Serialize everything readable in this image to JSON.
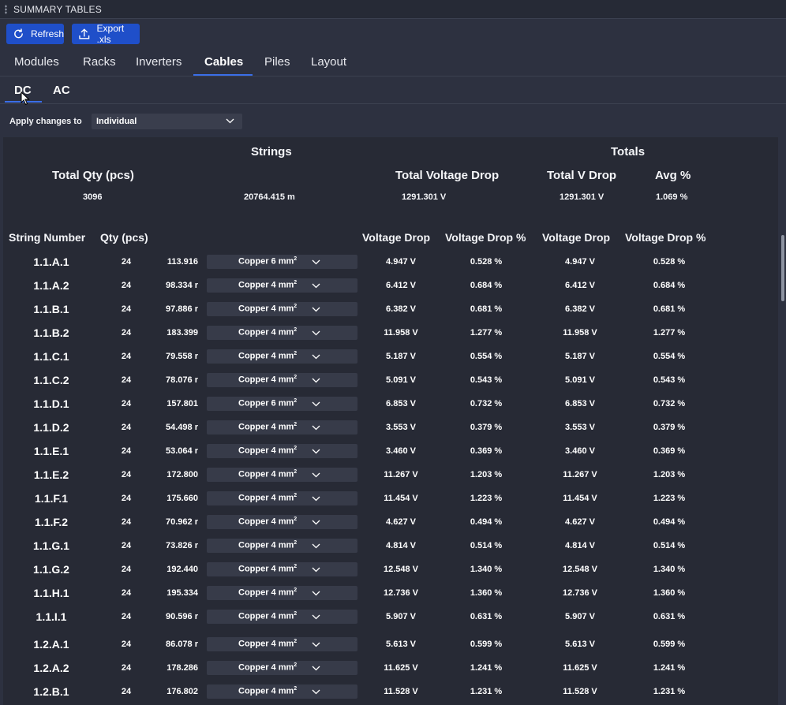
{
  "window": {
    "title": "SUMMARY TABLES"
  },
  "toolbar": {
    "refresh_label": "Refresh",
    "export_label": "Export .xls"
  },
  "tabs": [
    {
      "label": "Modules"
    },
    {
      "label": "Racks"
    },
    {
      "label": "Inverters"
    },
    {
      "label": "Cables",
      "active": true
    },
    {
      "label": "Piles"
    },
    {
      "label": "Layout"
    }
  ],
  "subtabs": [
    {
      "label": "DC",
      "active": true
    },
    {
      "label": "AC"
    }
  ],
  "apply": {
    "label": "Apply changes to",
    "selected": "Individual"
  },
  "summary": {
    "strings_header": "Strings",
    "totals_header": "Totals",
    "total_qty_label": "Total Qty (pcs)",
    "total_vdrop_label": "Total Voltage Drop",
    "totals_vdrop_label": "Total V Drop",
    "avg_label": "Avg %",
    "total_qty": "3096",
    "total_length": "20764.415 m",
    "total_vdrop": "1291.301 V",
    "totals_vdrop": "1291.301 V",
    "avg_pct": "1.069 %"
  },
  "columns": {
    "string_number": "String Number",
    "qty": "Qty (pcs)",
    "vdrop": "Voltage Drop",
    "vdrop_pct": "Voltage Drop %",
    "tot_vdrop": "Voltage Drop",
    "tot_vdrop_pct": "Voltage Drop %"
  },
  "rows": [
    {
      "sn": "1.1.A.1",
      "qty": "24",
      "len": "113.916",
      "cable": "Copper 6 mm",
      "vd": "4.947 V",
      "vp": "0.528 %",
      "tvd": "4.947 V",
      "tvp": "0.528 %"
    },
    {
      "sn": "1.1.A.2",
      "qty": "24",
      "len": "98.334 r",
      "cable": "Copper 4 mm",
      "vd": "6.412 V",
      "vp": "0.684 %",
      "tvd": "6.412 V",
      "tvp": "0.684 %"
    },
    {
      "sn": "1.1.B.1",
      "qty": "24",
      "len": "97.886 r",
      "cable": "Copper 4 mm",
      "vd": "6.382 V",
      "vp": "0.681 %",
      "tvd": "6.382 V",
      "tvp": "0.681 %"
    },
    {
      "sn": "1.1.B.2",
      "qty": "24",
      "len": "183.399",
      "cable": "Copper 4 mm",
      "vd": "11.958 V",
      "vp": "1.277 %",
      "tvd": "11.958 V",
      "tvp": "1.277 %"
    },
    {
      "sn": "1.1.C.1",
      "qty": "24",
      "len": "79.558 r",
      "cable": "Copper 4 mm",
      "vd": "5.187 V",
      "vp": "0.554 %",
      "tvd": "5.187 V",
      "tvp": "0.554 %"
    },
    {
      "sn": "1.1.C.2",
      "qty": "24",
      "len": "78.076 r",
      "cable": "Copper 4 mm",
      "vd": "5.091 V",
      "vp": "0.543 %",
      "tvd": "5.091 V",
      "tvp": "0.543 %"
    },
    {
      "sn": "1.1.D.1",
      "qty": "24",
      "len": "157.801",
      "cable": "Copper 6 mm",
      "vd": "6.853 V",
      "vp": "0.732 %",
      "tvd": "6.853 V",
      "tvp": "0.732 %"
    },
    {
      "sn": "1.1.D.2",
      "qty": "24",
      "len": "54.498 r",
      "cable": "Copper 4 mm",
      "vd": "3.553 V",
      "vp": "0.379 %",
      "tvd": "3.553 V",
      "tvp": "0.379 %"
    },
    {
      "sn": "1.1.E.1",
      "qty": "24",
      "len": "53.064 r",
      "cable": "Copper 4 mm",
      "vd": "3.460 V",
      "vp": "0.369 %",
      "tvd": "3.460 V",
      "tvp": "0.369 %"
    },
    {
      "sn": "1.1.E.2",
      "qty": "24",
      "len": "172.800",
      "cable": "Copper 4 mm",
      "vd": "11.267 V",
      "vp": "1.203 %",
      "tvd": "11.267 V",
      "tvp": "1.203 %"
    },
    {
      "sn": "1.1.F.1",
      "qty": "24",
      "len": "175.660",
      "cable": "Copper 4 mm",
      "vd": "11.454 V",
      "vp": "1.223 %",
      "tvd": "11.454 V",
      "tvp": "1.223 %"
    },
    {
      "sn": "1.1.F.2",
      "qty": "24",
      "len": "70.962 r",
      "cable": "Copper 4 mm",
      "vd": "4.627 V",
      "vp": "0.494 %",
      "tvd": "4.627 V",
      "tvp": "0.494 %"
    },
    {
      "sn": "1.1.G.1",
      "qty": "24",
      "len": "73.826 r",
      "cable": "Copper 4 mm",
      "vd": "4.814 V",
      "vp": "0.514 %",
      "tvd": "4.814 V",
      "tvp": "0.514 %"
    },
    {
      "sn": "1.1.G.2",
      "qty": "24",
      "len": "192.440",
      "cable": "Copper 4 mm",
      "vd": "12.548 V",
      "vp": "1.340 %",
      "tvd": "12.548 V",
      "tvp": "1.340 %"
    },
    {
      "sn": "1.1.H.1",
      "qty": "24",
      "len": "195.334",
      "cable": "Copper 4 mm",
      "vd": "12.736 V",
      "vp": "1.360 %",
      "tvd": "12.736 V",
      "tvp": "1.360 %"
    },
    {
      "sn": "1.1.I.1",
      "qty": "24",
      "len": "90.596 r",
      "cable": "Copper 4 mm",
      "vd": "5.907 V",
      "vp": "0.631 %",
      "tvd": "5.907 V",
      "tvp": "0.631 %"
    },
    {
      "sn": "1.2.A.1",
      "qty": "24",
      "len": "86.078 r",
      "cable": "Copper 4 mm",
      "vd": "5.613 V",
      "vp": "0.599 %",
      "tvd": "5.613 V",
      "tvp": "0.599 %"
    },
    {
      "sn": "1.2.A.2",
      "qty": "24",
      "len": "178.286",
      "cable": "Copper 4 mm",
      "vd": "11.625 V",
      "vp": "1.241 %",
      "tvd": "11.625 V",
      "tvp": "1.241 %"
    },
    {
      "sn": "1.2.B.1",
      "qty": "24",
      "len": "176.802",
      "cable": "Copper 4 mm",
      "vd": "11.528 V",
      "vp": "1.231 %",
      "tvd": "11.528 V",
      "tvp": "1.231 %"
    }
  ],
  "icons": {
    "refresh": "refresh-icon",
    "export": "upload-icon",
    "dropdown": "chevron-down-icon",
    "grip": "drag-grip-icon",
    "cursor": "mouse-pointer-icon"
  },
  "colors": {
    "accent": "#3a6ee8",
    "button": "#1f4fc9",
    "background": "#2d3140",
    "panel": "#272a35"
  }
}
